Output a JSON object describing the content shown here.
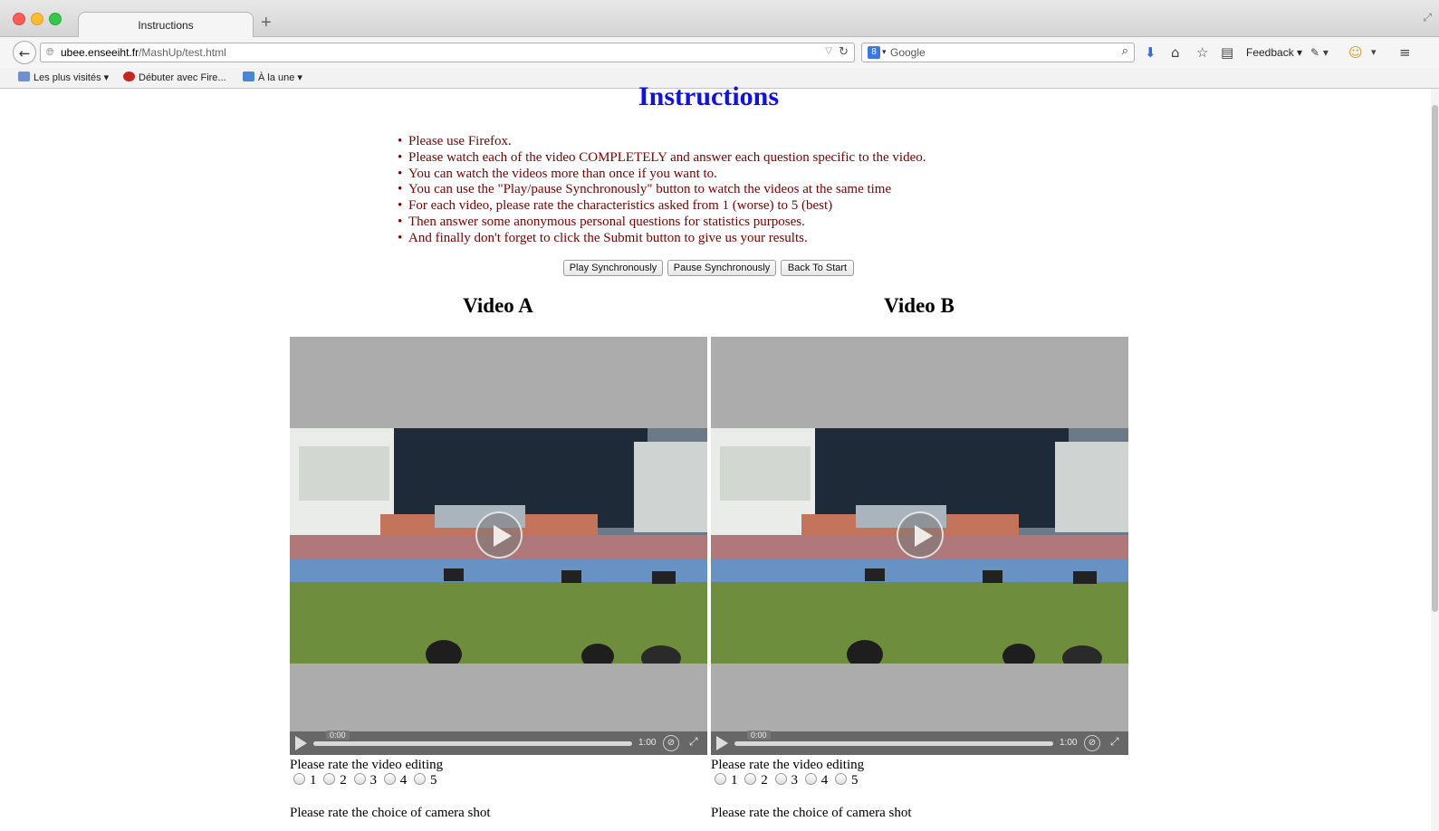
{
  "browser": {
    "tab_title": "Instructions",
    "url_host": "ubee.enseeiht.fr",
    "url_path": "/MashUp/test.html",
    "search_placeholder": "Google",
    "feedback_label": "Feedback",
    "bookmarks": [
      "Les plus visités",
      "Débuter avec Fire...",
      "À la une"
    ]
  },
  "page": {
    "title": "Instructions",
    "instructions": [
      "Please use Firefox.",
      "Please watch each of the video COMPLETELY and answer each question specific to the video.",
      "You can watch the videos more than once if you want to.",
      "You can use the \"Play/pause Synchronously\" button to watch the videos at the same time",
      "For each video, please rate the characteristics asked from 1 (worse) to 5 (best)",
      "Then answer some anonymous personal questions for statistics purposes.",
      "And finally don't forget to click the Submit button to give us your results."
    ],
    "buttons": {
      "play_sync": "Play Synchronously",
      "pause_sync": "Pause Synchronously",
      "back_to_start": "Back To Start"
    }
  },
  "videos": [
    {
      "heading": "Video A",
      "time_current": "0:00",
      "time_total": "1:00",
      "question_1": "Please rate the video editing",
      "question_2": "Please rate the choice of camera shot",
      "options": [
        "1",
        "2",
        "3",
        "4",
        "5"
      ]
    },
    {
      "heading": "Video B",
      "time_current": "0:00",
      "time_total": "1:00",
      "question_1": "Please rate the video editing",
      "question_2": "Please rate the choice of camera shot",
      "options": [
        "1",
        "2",
        "3",
        "4",
        "5"
      ]
    }
  ]
}
